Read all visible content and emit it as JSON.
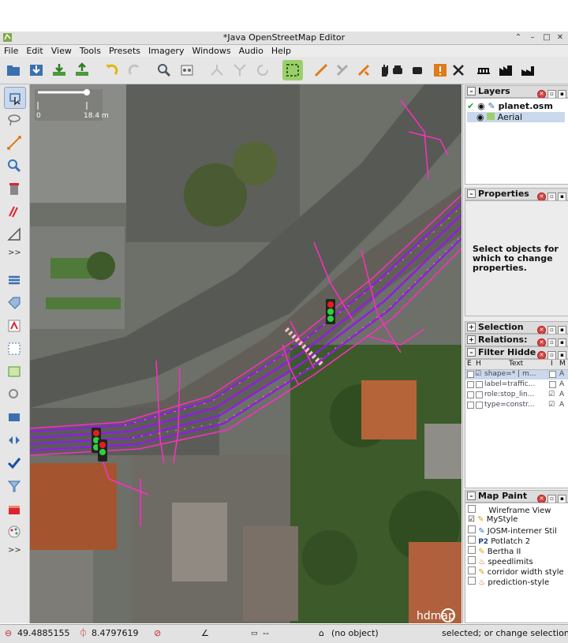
{
  "window": {
    "title": "*Java OpenStreetMap Editor"
  },
  "menu": [
    "File",
    "Edit",
    "View",
    "Tools",
    "Presets",
    "Imagery",
    "Windows",
    "Audio",
    "Help"
  ],
  "toolbar": {
    "icons": [
      "open-icon",
      "save-icon",
      "download-icon",
      "upload-icon",
      "undo-icon",
      "redo-icon",
      "zoom-icon",
      "preferences-icon",
      "split-icon",
      "merge-icon",
      "refresh-icon",
      "select-area-icon",
      "draw-icon",
      "tools-icon",
      "tools2-icon",
      "hand-icon",
      "car-icon",
      "car2-icon",
      "warning-icon",
      "cross-icon",
      "bridge-icon",
      "building-icon",
      "factory-icon"
    ]
  },
  "map": {
    "scale_label_start": "0",
    "scale_label_end": "18.4 m",
    "watermark": "hdmap"
  },
  "layers": {
    "title": "Layers",
    "items": [
      {
        "name": "planet.osm",
        "active": true
      },
      {
        "name": "Aerial",
        "active": false
      }
    ]
  },
  "properties": {
    "title": "Properties",
    "empty_message": "Select objects for which to change properties."
  },
  "selection": {
    "title": "Selection"
  },
  "relations": {
    "title": "Relations:"
  },
  "filter": {
    "title": "Filter Hidde",
    "columns": [
      "E",
      "H",
      "Text",
      "I",
      "M"
    ],
    "rows": [
      {
        "text": "shape=* | m...",
        "e": false,
        "h": true,
        "i": false,
        "m": "A",
        "selected": true
      },
      {
        "text": "label=traffic...",
        "e": false,
        "h": false,
        "i": false,
        "m": "A",
        "selected": false
      },
      {
        "text": "role:stop_lin...",
        "e": false,
        "h": false,
        "i": true,
        "m": "A",
        "selected": false
      },
      {
        "text": "type=constr...",
        "e": false,
        "h": false,
        "i": true,
        "m": "A",
        "selected": false
      }
    ]
  },
  "map_paint": {
    "title": "Map Paint",
    "items": [
      {
        "label": "Wireframe View",
        "checked": false,
        "prefix": ""
      },
      {
        "label": "MyStyle",
        "checked": true,
        "prefix": ""
      },
      {
        "label": "JOSM-interner Stil",
        "checked": false,
        "prefix": ""
      },
      {
        "label": "Potlatch 2",
        "checked": false,
        "prefix": "P2"
      },
      {
        "label": "Bertha II",
        "checked": false,
        "prefix": ""
      },
      {
        "label": "speedlimits",
        "checked": false,
        "prefix": ""
      },
      {
        "label": "corridor width style",
        "checked": false,
        "prefix": ""
      },
      {
        "label": "prediction-style",
        "checked": false,
        "prefix": ""
      }
    ]
  },
  "status": {
    "lat": "49.4885155",
    "lon": "8.4797619",
    "angle": "",
    "length": "--",
    "object": "(no object)",
    "help": "selected; or change selection"
  }
}
